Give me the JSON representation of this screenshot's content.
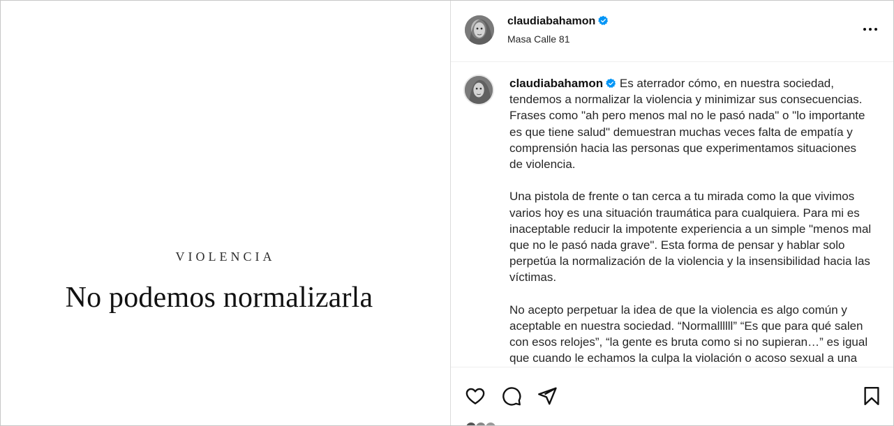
{
  "image": {
    "eyebrow": "VIOLENCIA",
    "headline": "No podemos normalizarla"
  },
  "header": {
    "username": "claudiabahamon",
    "location": "Masa Calle 81",
    "verified": true,
    "more_icon": "more-horizontal-icon"
  },
  "caption": {
    "username": "claudiabahamon",
    "paragraphs": [
      "Es aterrador cómo, en nuestra sociedad, tendemos a normalizar la violencia y minimizar sus consecuencias. Frases como \"ah pero menos mal no le pasó nada\" o \"lo importante es que tiene salud\" demuestran muchas veces falta de empatía y comprensión hacia las personas que experimentamos situaciones de violencia.",
      "Una pistola de frente o tan cerca a tu mirada como la que vivimos varios hoy es una situación traumática para cualquiera. Para mi es inaceptable reducir la impotente experiencia a un simple \"menos mal que no le pasó nada grave\". Esta forma de pensar y hablar solo perpetúa la normalización de la violencia y la insensibilidad hacia las víctimas.",
      "No acepto perpetuar la idea de que la violencia es algo común y aceptable en nuestra sociedad. “Normallllll” “Es que para qué salen con esos relojes”, “la gente es bruta como si no supieran…” es igual que cuando le echamos la culpa la violación o acoso sexual a una mujer porque ‘se le vio la minifalda’ o algo así."
    ]
  },
  "actions": {
    "icons": [
      "heart-icon",
      "comment-icon",
      "share-icon",
      "bookmark-icon"
    ]
  },
  "colors": {
    "verified": "#0095f6",
    "text": "#262626",
    "divider": "#dbdbdb"
  }
}
